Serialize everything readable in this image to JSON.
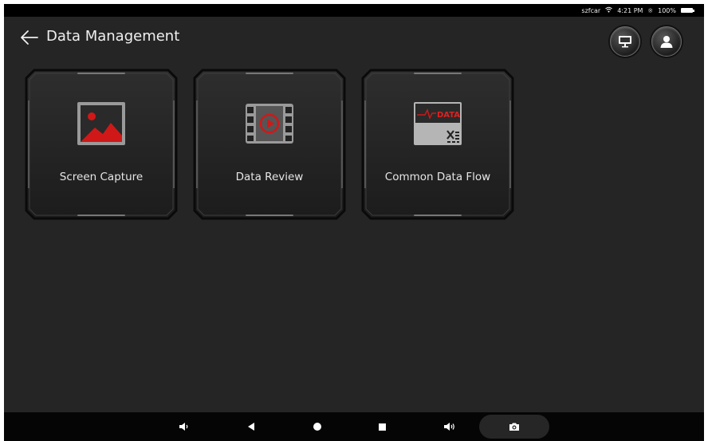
{
  "status_bar": {
    "carrier": "szfcar",
    "time": "4:21 PM",
    "battery": "100%"
  },
  "header": {
    "title": "Data Management",
    "back_icon": "arrow-left-icon",
    "right_buttons": [
      "monitor-icon",
      "user-icon"
    ]
  },
  "tiles": [
    {
      "label": "Screen Capture",
      "icon": "image-icon"
    },
    {
      "label": "Data Review",
      "icon": "film-play-icon"
    },
    {
      "label": "Common Data Flow",
      "icon": "data-chart-icon",
      "icon_text": "DATA"
    }
  ],
  "nav_bar": {
    "buttons": [
      "volume-down-icon",
      "back-triangle-icon",
      "home-circle-icon",
      "recent-square-icon",
      "volume-up-icon",
      "camera-icon"
    ]
  },
  "colors": {
    "background": "#252525",
    "accent_red": "#d01818",
    "bar": "#000000"
  }
}
